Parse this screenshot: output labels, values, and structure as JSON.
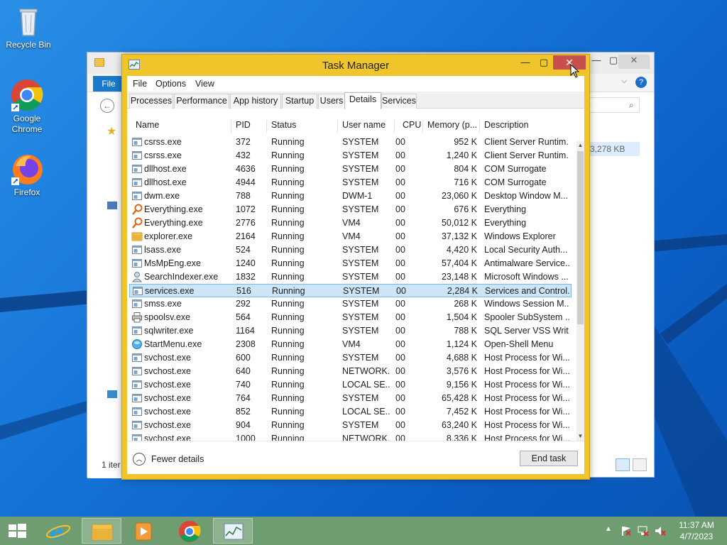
{
  "desktop": {
    "icons": [
      {
        "label": "Recycle Bin"
      },
      {
        "label": "Google Chrome"
      },
      {
        "label": "Firefox"
      }
    ]
  },
  "explorer": {
    "file_tab": "File",
    "size_value": "3,278 KB",
    "status_text": "1 iter"
  },
  "task_manager": {
    "title": "Task Manager",
    "menu": [
      "File",
      "Options",
      "View"
    ],
    "tabs": [
      "Processes",
      "Performance",
      "App history",
      "Startup",
      "Users",
      "Details",
      "Services"
    ],
    "active_tab": "Details",
    "columns": [
      "Name",
      "PID",
      "Status",
      "User name",
      "CPU",
      "Memory (p...",
      "Description"
    ],
    "rows": [
      {
        "name": "csrss.exe",
        "pid": "372",
        "status": "Running",
        "user": "SYSTEM",
        "cpu": "00",
        "mem": "952 K",
        "desc": "Client Server Runtim...",
        "icon": "app"
      },
      {
        "name": "csrss.exe",
        "pid": "432",
        "status": "Running",
        "user": "SYSTEM",
        "cpu": "00",
        "mem": "1,240 K",
        "desc": "Client Server Runtim...",
        "icon": "app"
      },
      {
        "name": "dllhost.exe",
        "pid": "4636",
        "status": "Running",
        "user": "SYSTEM",
        "cpu": "00",
        "mem": "804 K",
        "desc": "COM Surrogate",
        "icon": "app"
      },
      {
        "name": "dllhost.exe",
        "pid": "4944",
        "status": "Running",
        "user": "SYSTEM",
        "cpu": "00",
        "mem": "716 K",
        "desc": "COM Surrogate",
        "icon": "app"
      },
      {
        "name": "dwm.exe",
        "pid": "788",
        "status": "Running",
        "user": "DWM-1",
        "cpu": "00",
        "mem": "23,060 K",
        "desc": "Desktop Window M...",
        "icon": "app"
      },
      {
        "name": "Everything.exe",
        "pid": "1072",
        "status": "Running",
        "user": "SYSTEM",
        "cpu": "00",
        "mem": "676 K",
        "desc": "Everything",
        "icon": "magnifier"
      },
      {
        "name": "Everything.exe",
        "pid": "2776",
        "status": "Running",
        "user": "VM4",
        "cpu": "00",
        "mem": "50,012 K",
        "desc": "Everything",
        "icon": "magnifier"
      },
      {
        "name": "explorer.exe",
        "pid": "2164",
        "status": "Running",
        "user": "VM4",
        "cpu": "00",
        "mem": "37,132 K",
        "desc": "Windows Explorer",
        "icon": "folder"
      },
      {
        "name": "lsass.exe",
        "pid": "524",
        "status": "Running",
        "user": "SYSTEM",
        "cpu": "00",
        "mem": "4,420 K",
        "desc": "Local Security Auth...",
        "icon": "app"
      },
      {
        "name": "MsMpEng.exe",
        "pid": "1240",
        "status": "Running",
        "user": "SYSTEM",
        "cpu": "00",
        "mem": "57,404 K",
        "desc": "Antimalware Service...",
        "icon": "app"
      },
      {
        "name": "SearchIndexer.exe",
        "pid": "1832",
        "status": "Running",
        "user": "SYSTEM",
        "cpu": "00",
        "mem": "23,148 K",
        "desc": "Microsoft Windows ...",
        "icon": "search-person"
      },
      {
        "name": "services.exe",
        "pid": "516",
        "status": "Running",
        "user": "SYSTEM",
        "cpu": "00",
        "mem": "2,284 K",
        "desc": "Services and Control...",
        "icon": "app",
        "selected": true
      },
      {
        "name": "smss.exe",
        "pid": "292",
        "status": "Running",
        "user": "SYSTEM",
        "cpu": "00",
        "mem": "268 K",
        "desc": "Windows Session M...",
        "icon": "app"
      },
      {
        "name": "spoolsv.exe",
        "pid": "564",
        "status": "Running",
        "user": "SYSTEM",
        "cpu": "00",
        "mem": "1,504 K",
        "desc": "Spooler SubSystem ...",
        "icon": "printer"
      },
      {
        "name": "sqlwriter.exe",
        "pid": "1164",
        "status": "Running",
        "user": "SYSTEM",
        "cpu": "00",
        "mem": "788 K",
        "desc": "SQL Server VSS Writ...",
        "icon": "app"
      },
      {
        "name": "StartMenu.exe",
        "pid": "2308",
        "status": "Running",
        "user": "VM4",
        "cpu": "00",
        "mem": "1,124 K",
        "desc": "Open-Shell Menu",
        "icon": "shell"
      },
      {
        "name": "svchost.exe",
        "pid": "600",
        "status": "Running",
        "user": "SYSTEM",
        "cpu": "00",
        "mem": "4,688 K",
        "desc": "Host Process for Wi...",
        "icon": "app"
      },
      {
        "name": "svchost.exe",
        "pid": "640",
        "status": "Running",
        "user": "NETWORK...",
        "cpu": "00",
        "mem": "3,576 K",
        "desc": "Host Process for Wi...",
        "icon": "app"
      },
      {
        "name": "svchost.exe",
        "pid": "740",
        "status": "Running",
        "user": "LOCAL SE...",
        "cpu": "00",
        "mem": "9,156 K",
        "desc": "Host Process for Wi...",
        "icon": "app"
      },
      {
        "name": "svchost.exe",
        "pid": "764",
        "status": "Running",
        "user": "SYSTEM",
        "cpu": "00",
        "mem": "65,428 K",
        "desc": "Host Process for Wi...",
        "icon": "app"
      },
      {
        "name": "svchost.exe",
        "pid": "852",
        "status": "Running",
        "user": "LOCAL SE...",
        "cpu": "00",
        "mem": "7,452 K",
        "desc": "Host Process for Wi...",
        "icon": "app"
      },
      {
        "name": "svchost.exe",
        "pid": "904",
        "status": "Running",
        "user": "SYSTEM",
        "cpu": "00",
        "mem": "63,240 K",
        "desc": "Host Process for Wi...",
        "icon": "app"
      },
      {
        "name": "svchost.exe",
        "pid": "1000",
        "status": "Running",
        "user": "NETWORK...",
        "cpu": "00",
        "mem": "8,336 K",
        "desc": "Host Process for Wi...",
        "icon": "app"
      }
    ],
    "footer": {
      "fewer_details": "Fewer details",
      "end_task": "End task"
    }
  },
  "taskbar": {
    "clock_time": "11:37 AM",
    "clock_date": "4/7/2023"
  },
  "colors": {
    "tm_frame": "#f0c52c",
    "close_button": "#c7504c",
    "taskbar": "#6f9c71",
    "selected_row": "#cce5f7"
  }
}
